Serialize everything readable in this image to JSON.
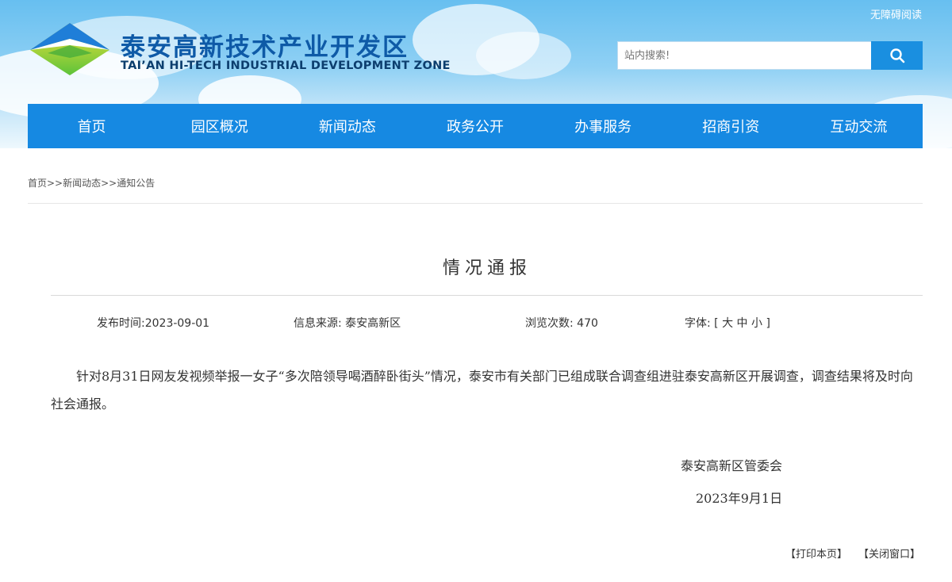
{
  "header": {
    "accessibility_link": "无障碍阅读",
    "logo_title": "泰安高新技术产业开发区",
    "logo_subtitle": "TAI’AN HI-TECH INDUSTRIAL DEVELOPMENT ZONE",
    "search_placeholder": "站内搜索!",
    "search_icon": "search-icon"
  },
  "nav": {
    "items": [
      "首页",
      "园区概况",
      "新闻动态",
      "政务公开",
      "办事服务",
      "招商引资",
      "互动交流"
    ]
  },
  "breadcrumb": "首页>>新闻动态>>通知公告",
  "article": {
    "title": "情况通报",
    "date_label": "发布时间:2023-09-01",
    "source_label": "信息来源:  泰安高新区",
    "views_label": "浏览次数:  470",
    "font_label": "字体:",
    "font_open": "[",
    "font_large": "大",
    "font_medium": "中",
    "font_small": "小",
    "font_close": "]",
    "body": "针对8月31日网友发视频举报一女子“多次陪领导喝酒醉卧街头”情况，泰安市有关部门已组成联合调查组进驻泰安高新区开展调查，调查结果将及时向社会通报。",
    "sign_org": "泰安高新区管委会",
    "sign_date": "2023年9月1日"
  },
  "actions": {
    "print": "【打印本页】",
    "close": "【关闭窗口】"
  },
  "colors": {
    "nav_bg": "#1689e2",
    "search_btn": "#1a8fe0",
    "logo_title": "#0e5aa7"
  }
}
